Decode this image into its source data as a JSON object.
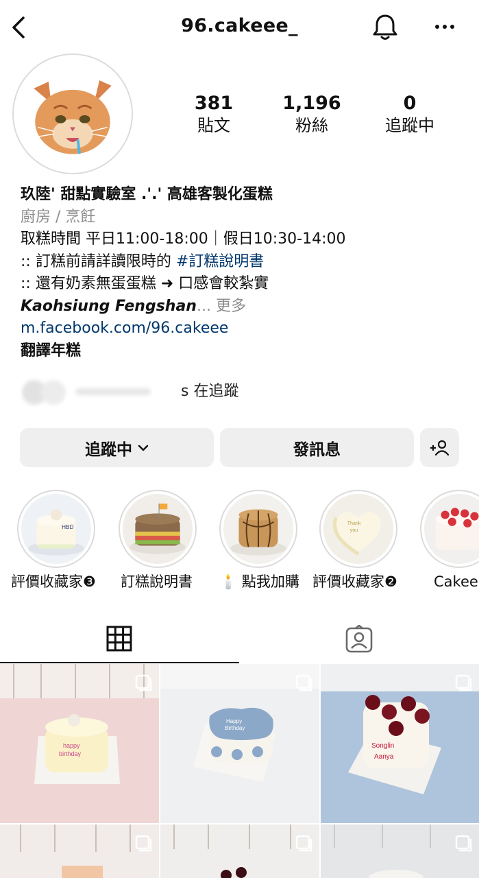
{
  "header": {
    "username": "96.cakeee_",
    "back_icon": "chevron-left-icon",
    "bell_icon": "bell-icon",
    "more_icon": "ellipsis-icon"
  },
  "stats": [
    {
      "value": "381",
      "label": "貼文"
    },
    {
      "value": "1,196",
      "label": "粉絲"
    },
    {
      "value": "0",
      "label": "追蹤中"
    }
  ],
  "bio": {
    "name": "玖陸' 甜點實驗室 .'.' 高雄客製化蛋糕",
    "category": "廚房 / 烹飪",
    "line1": "取糕時間 平日11:00-18:00｜假日10:30-14:00",
    "line2_prefix": ":: 訂糕前請詳讀限時的 ",
    "line2_hashtag": "#訂糕說明書",
    "line3": ":: 還有奶素無蛋蛋糕 ➜ 口感會較紮實",
    "location": "Kaohsiung Fengshan",
    "ellipsis": "... ",
    "more": "更多",
    "link": "m.facebook.com/96.cakeee",
    "translate": "翻譯年糕"
  },
  "followed_by": {
    "text": "s 在追蹤"
  },
  "buttons": {
    "following": "追蹤中",
    "message": "發訊息"
  },
  "highlights": [
    {
      "label": "評價收藏家❸"
    },
    {
      "label": "訂糕說明書"
    },
    {
      "label": "🕯️ 點我加購"
    },
    {
      "label": "評價收藏家❷"
    },
    {
      "label": "Cakeee"
    }
  ],
  "colors": {
    "link": "#00376b",
    "secondary": "#8e8e8e",
    "button_bg": "#efefef",
    "border": "#dbdbdb"
  }
}
